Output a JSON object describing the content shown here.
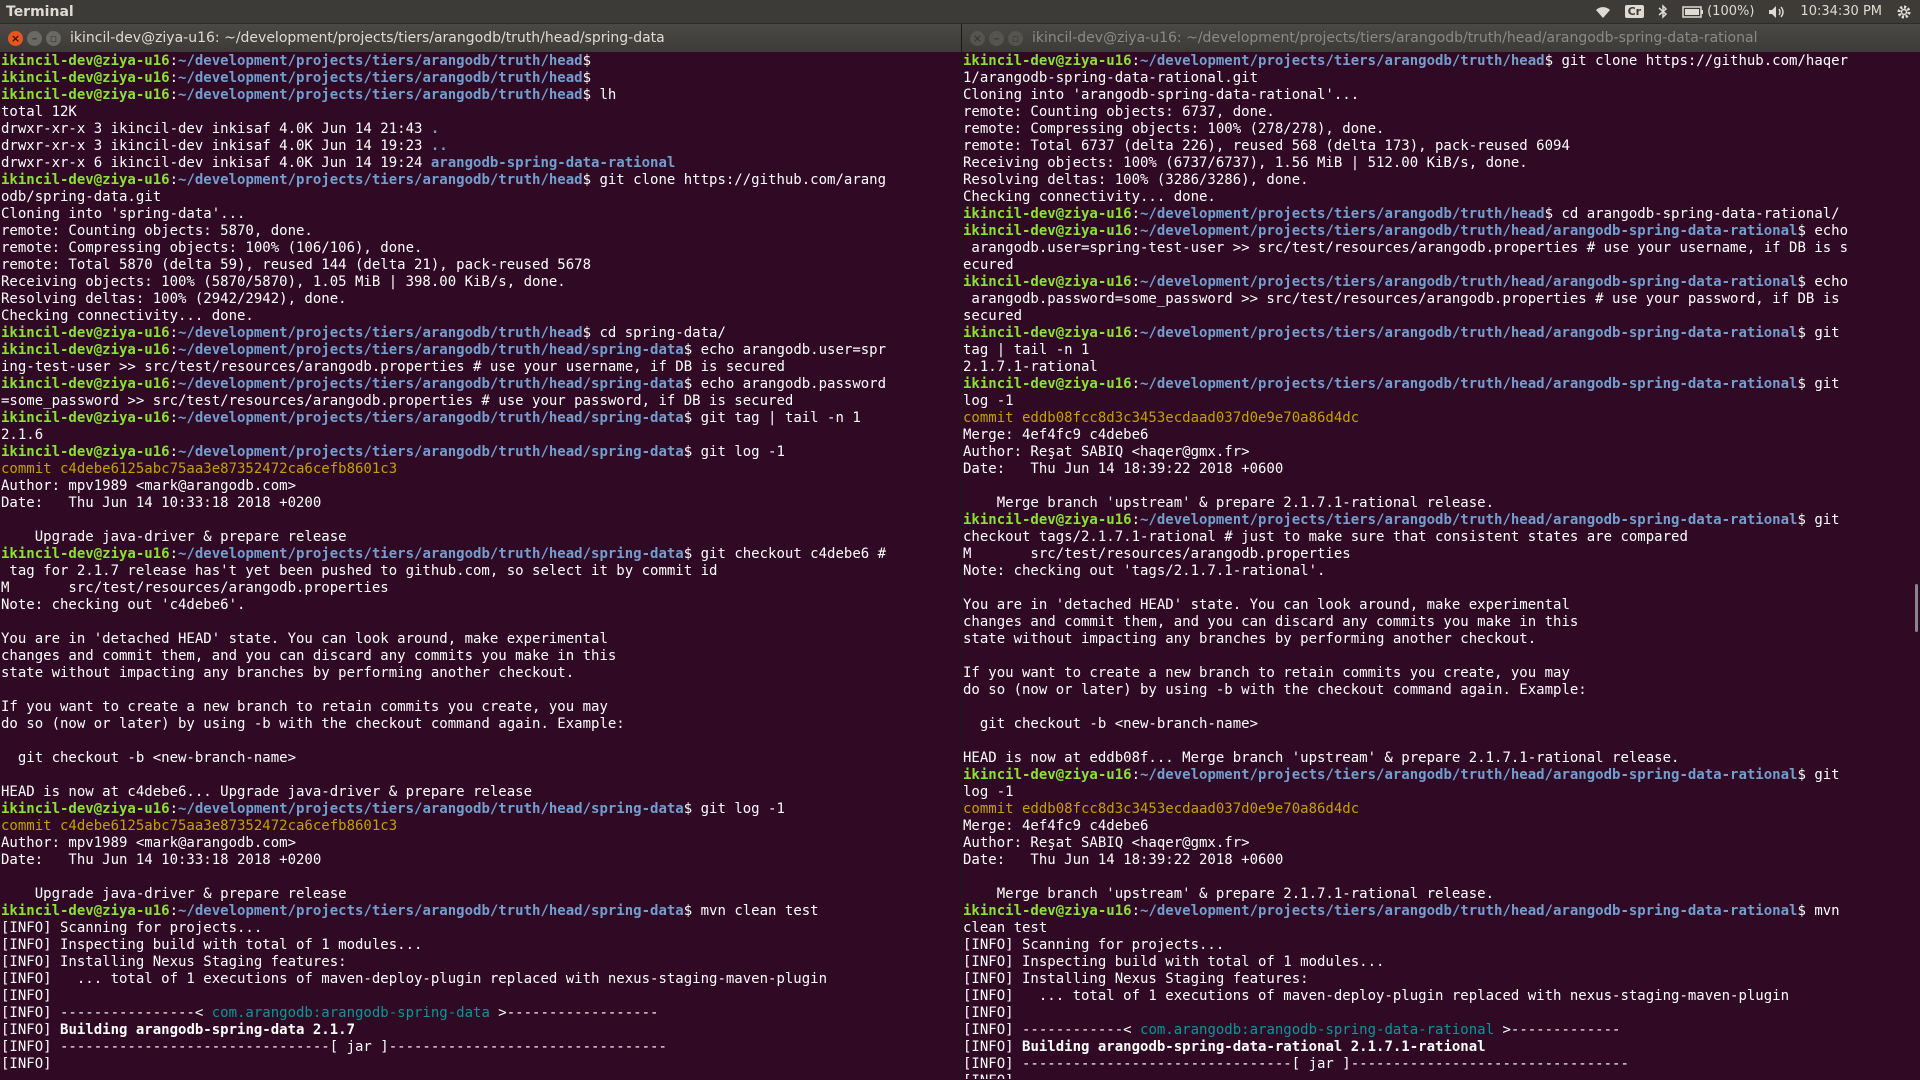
{
  "topbar": {
    "app_title": "Terminal",
    "keyboard_layout": "Cr",
    "battery": "(100%)",
    "time": "10:34:30 PM",
    "icons": [
      "wifi-icon",
      "keyboard-layout-indicator",
      "bluetooth-icon",
      "battery-icon",
      "volume-icon",
      "gear-icon"
    ]
  },
  "windows": [
    {
      "id": "left",
      "title": "ikincil-dev@ziya-u16: ~/development/projects/tiers/arangodb/truth/head/spring-data",
      "active": true,
      "lines": [
        {
          "t": "p",
          "u": "ikincil-dev@ziya-u16",
          "p": "~/development/projects/tiers/arangodb/truth/head",
          "cmd": ""
        },
        {
          "t": "p",
          "u": "ikincil-dev@ziya-u16",
          "p": "~/development/projects/tiers/arangodb/truth/head",
          "cmd": ""
        },
        {
          "t": "p",
          "u": "ikincil-dev@ziya-u16",
          "p": "~/development/projects/tiers/arangodb/truth/head",
          "cmd": " lh"
        },
        {
          "t": "o",
          "s": "total 12K"
        },
        {
          "t": "o",
          "s": "drwxr-xr-x 3 ikincil-dev inkisaf 4.0K Jun 14 21:43 ",
          "dir": "."
        },
        {
          "t": "o",
          "s": "drwxr-xr-x 3 ikincil-dev inkisaf 4.0K Jun 14 19:23 ",
          "dir": ".."
        },
        {
          "t": "o",
          "s": "drwxr-xr-x 6 ikincil-dev inkisaf 4.0K Jun 14 19:24 ",
          "dir": "arangodb-spring-data-rational"
        },
        {
          "t": "p",
          "u": "ikincil-dev@ziya-u16",
          "p": "~/development/projects/tiers/arangodb/truth/head",
          "cmd": " git clone https://github.com/arang"
        },
        {
          "t": "o",
          "s": "odb/spring-data.git"
        },
        {
          "t": "o",
          "s": "Cloning into 'spring-data'..."
        },
        {
          "t": "o",
          "s": "remote: Counting objects: 5870, done."
        },
        {
          "t": "o",
          "s": "remote: Compressing objects: 100% (106/106), done."
        },
        {
          "t": "o",
          "s": "remote: Total 5870 (delta 59), reused 144 (delta 21), pack-reused 5678"
        },
        {
          "t": "o",
          "s": "Receiving objects: 100% (5870/5870), 1.05 MiB | 398.00 KiB/s, done."
        },
        {
          "t": "o",
          "s": "Resolving deltas: 100% (2942/2942), done."
        },
        {
          "t": "o",
          "s": "Checking connectivity... done."
        },
        {
          "t": "p",
          "u": "ikincil-dev@ziya-u16",
          "p": "~/development/projects/tiers/arangodb/truth/head",
          "cmd": " cd spring-data/"
        },
        {
          "t": "p",
          "u": "ikincil-dev@ziya-u16",
          "p": "~/development/projects/tiers/arangodb/truth/head/spring-data",
          "cmd": " echo arangodb.user=spr"
        },
        {
          "t": "o",
          "s": "ing-test-user >> src/test/resources/arangodb.properties # use your username, if DB is secured"
        },
        {
          "t": "p",
          "u": "ikincil-dev@ziya-u16",
          "p": "~/development/projects/tiers/arangodb/truth/head/spring-data",
          "cmd": " echo arangodb.password"
        },
        {
          "t": "o",
          "s": "=some_password >> src/test/resources/arangodb.properties # use your password, if DB is secured"
        },
        {
          "t": "p",
          "u": "ikincil-dev@ziya-u16",
          "p": "~/development/projects/tiers/arangodb/truth/head/spring-data",
          "cmd": " git tag | tail -n 1"
        },
        {
          "t": "o",
          "s": "2.1.6"
        },
        {
          "t": "p",
          "u": "ikincil-dev@ziya-u16",
          "p": "~/development/projects/tiers/arangodb/truth/head/spring-data",
          "cmd": " git log -1"
        },
        {
          "t": "h",
          "s": "commit c4debe6125abc75aa3e87352472ca6cefb8601c3"
        },
        {
          "t": "o",
          "s": "Author: mpv1989 <mark@arangodb.com>"
        },
        {
          "t": "o",
          "s": "Date:   Thu Jun 14 10:33:18 2018 +0200"
        },
        {
          "t": "o",
          "s": ""
        },
        {
          "t": "o",
          "s": "    Upgrade java-driver & prepare release"
        },
        {
          "t": "p",
          "u": "ikincil-dev@ziya-u16",
          "p": "~/development/projects/tiers/arangodb/truth/head/spring-data",
          "cmd": " git checkout c4debe6 #"
        },
        {
          "t": "o",
          "s": " tag for 2.1.7 release has't yet been pushed to github.com, so select it by commit id"
        },
        {
          "t": "o",
          "s": "M       src/test/resources/arangodb.properties"
        },
        {
          "t": "o",
          "s": "Note: checking out 'c4debe6'."
        },
        {
          "t": "o",
          "s": ""
        },
        {
          "t": "o",
          "s": "You are in 'detached HEAD' state. You can look around, make experimental"
        },
        {
          "t": "o",
          "s": "changes and commit them, and you can discard any commits you make in this"
        },
        {
          "t": "o",
          "s": "state without impacting any branches by performing another checkout."
        },
        {
          "t": "o",
          "s": ""
        },
        {
          "t": "o",
          "s": "If you want to create a new branch to retain commits you create, you may"
        },
        {
          "t": "o",
          "s": "do so (now or later) by using -b with the checkout command again. Example:"
        },
        {
          "t": "o",
          "s": ""
        },
        {
          "t": "o",
          "s": "  git checkout -b <new-branch-name>"
        },
        {
          "t": "o",
          "s": ""
        },
        {
          "t": "o",
          "s": "HEAD is now at c4debe6... Upgrade java-driver & prepare release"
        },
        {
          "t": "p",
          "u": "ikincil-dev@ziya-u16",
          "p": "~/development/projects/tiers/arangodb/truth/head/spring-data",
          "cmd": " git log -1"
        },
        {
          "t": "h",
          "s": "commit c4debe6125abc75aa3e87352472ca6cefb8601c3"
        },
        {
          "t": "o",
          "s": "Author: mpv1989 <mark@arangodb.com>"
        },
        {
          "t": "o",
          "s": "Date:   Thu Jun 14 10:33:18 2018 +0200"
        },
        {
          "t": "o",
          "s": ""
        },
        {
          "t": "o",
          "s": "    Upgrade java-driver & prepare release"
        },
        {
          "t": "p",
          "u": "ikincil-dev@ziya-u16",
          "p": "~/development/projects/tiers/arangodb/truth/head/spring-data",
          "cmd": " mvn clean test"
        },
        {
          "t": "o",
          "s": "[INFO] Scanning for projects..."
        },
        {
          "t": "o",
          "s": "[INFO] Inspecting build with total of 1 modules..."
        },
        {
          "t": "o",
          "s": "[INFO] Installing Nexus Staging features:"
        },
        {
          "t": "o",
          "s": "[INFO]   ... total of 1 executions of maven-deploy-plugin replaced with nexus-staging-maven-plugin"
        },
        {
          "t": "o",
          "s": "[INFO]"
        },
        {
          "t": "a",
          "pre": "[INFO] ----------------< ",
          "art": "com.arangodb:arangodb-spring-data",
          "post": " >------------------"
        },
        {
          "t": "bi",
          "pre": "[INFO] ",
          "s": "Building arangodb-spring-data 2.1.7"
        },
        {
          "t": "o",
          "s": "[INFO] --------------------------------[ jar ]---------------------------------"
        },
        {
          "t": "o",
          "s": "[INFO]"
        }
      ]
    },
    {
      "id": "right",
      "title": "ikincil-dev@ziya-u16: ~/development/projects/tiers/arangodb/truth/head/arangodb-spring-data-rational",
      "active": false,
      "lines": [
        {
          "t": "p",
          "u": "ikincil-dev@ziya-u16",
          "p": "~/development/projects/tiers/arangodb/truth/head",
          "cmd": " git clone https://github.com/haqer"
        },
        {
          "t": "o",
          "s": "1/arangodb-spring-data-rational.git"
        },
        {
          "t": "o",
          "s": "Cloning into 'arangodb-spring-data-rational'..."
        },
        {
          "t": "o",
          "s": "remote: Counting objects: 6737, done."
        },
        {
          "t": "o",
          "s": "remote: Compressing objects: 100% (278/278), done."
        },
        {
          "t": "o",
          "s": "remote: Total 6737 (delta 226), reused 568 (delta 173), pack-reused 6094"
        },
        {
          "t": "o",
          "s": "Receiving objects: 100% (6737/6737), 1.56 MiB | 512.00 KiB/s, done."
        },
        {
          "t": "o",
          "s": "Resolving deltas: 100% (3286/3286), done."
        },
        {
          "t": "o",
          "s": "Checking connectivity... done."
        },
        {
          "t": "p",
          "u": "ikincil-dev@ziya-u16",
          "p": "~/development/projects/tiers/arangodb/truth/head",
          "cmd": " cd arangodb-spring-data-rational/"
        },
        {
          "t": "p",
          "u": "ikincil-dev@ziya-u16",
          "p": "~/development/projects/tiers/arangodb/truth/head/arangodb-spring-data-rational",
          "cmd": " echo"
        },
        {
          "t": "o",
          "s": " arangodb.user=spring-test-user >> src/test/resources/arangodb.properties # use your username, if DB is s"
        },
        {
          "t": "o",
          "s": "ecured"
        },
        {
          "t": "p",
          "u": "ikincil-dev@ziya-u16",
          "p": "~/development/projects/tiers/arangodb/truth/head/arangodb-spring-data-rational",
          "cmd": " echo"
        },
        {
          "t": "o",
          "s": " arangodb.password=some_password >> src/test/resources/arangodb.properties # use your password, if DB is"
        },
        {
          "t": "o",
          "s": "secured"
        },
        {
          "t": "p",
          "u": "ikincil-dev@ziya-u16",
          "p": "~/development/projects/tiers/arangodb/truth/head/arangodb-spring-data-rational",
          "cmd": " git"
        },
        {
          "t": "o",
          "s": "tag | tail -n 1"
        },
        {
          "t": "o",
          "s": "2.1.7.1-rational"
        },
        {
          "t": "p",
          "u": "ikincil-dev@ziya-u16",
          "p": "~/development/projects/tiers/arangodb/truth/head/arangodb-spring-data-rational",
          "cmd": " git"
        },
        {
          "t": "o",
          "s": "log -1"
        },
        {
          "t": "h",
          "s": "commit eddb08fcc8d3c3453ecdaad037d0e9e70a86d4dc"
        },
        {
          "t": "o",
          "s": "Merge: 4ef4fc9 c4debe6"
        },
        {
          "t": "o",
          "s": "Author: Reşat SABIQ <haqer@gmx.fr>"
        },
        {
          "t": "o",
          "s": "Date:   Thu Jun 14 18:39:22 2018 +0600"
        },
        {
          "t": "o",
          "s": ""
        },
        {
          "t": "o",
          "s": "    Merge branch 'upstream' & prepare 2.1.7.1-rational release."
        },
        {
          "t": "p",
          "u": "ikincil-dev@ziya-u16",
          "p": "~/development/projects/tiers/arangodb/truth/head/arangodb-spring-data-rational",
          "cmd": " git"
        },
        {
          "t": "o",
          "s": "checkout tags/2.1.7.1-rational # just to make sure that consistent states are compared"
        },
        {
          "t": "o",
          "s": "M       src/test/resources/arangodb.properties"
        },
        {
          "t": "o",
          "s": "Note: checking out 'tags/2.1.7.1-rational'."
        },
        {
          "t": "o",
          "s": ""
        },
        {
          "t": "o",
          "s": "You are in 'detached HEAD' state. You can look around, make experimental"
        },
        {
          "t": "o",
          "s": "changes and commit them, and you can discard any commits you make in this"
        },
        {
          "t": "o",
          "s": "state without impacting any branches by performing another checkout."
        },
        {
          "t": "o",
          "s": ""
        },
        {
          "t": "o",
          "s": "If you want to create a new branch to retain commits you create, you may"
        },
        {
          "t": "o",
          "s": "do so (now or later) by using -b with the checkout command again. Example:"
        },
        {
          "t": "o",
          "s": ""
        },
        {
          "t": "o",
          "s": "  git checkout -b <new-branch-name>"
        },
        {
          "t": "o",
          "s": ""
        },
        {
          "t": "o",
          "s": "HEAD is now at eddb08f... Merge branch 'upstream' & prepare 2.1.7.1-rational release."
        },
        {
          "t": "p",
          "u": "ikincil-dev@ziya-u16",
          "p": "~/development/projects/tiers/arangodb/truth/head/arangodb-spring-data-rational",
          "cmd": " git"
        },
        {
          "t": "o",
          "s": "log -1"
        },
        {
          "t": "h",
          "s": "commit eddb08fcc8d3c3453ecdaad037d0e9e70a86d4dc"
        },
        {
          "t": "o",
          "s": "Merge: 4ef4fc9 c4debe6"
        },
        {
          "t": "o",
          "s": "Author: Reşat SABIQ <haqer@gmx.fr>"
        },
        {
          "t": "o",
          "s": "Date:   Thu Jun 14 18:39:22 2018 +0600"
        },
        {
          "t": "o",
          "s": ""
        },
        {
          "t": "o",
          "s": "    Merge branch 'upstream' & prepare 2.1.7.1-rational release."
        },
        {
          "t": "p",
          "u": "ikincil-dev@ziya-u16",
          "p": "~/development/projects/tiers/arangodb/truth/head/arangodb-spring-data-rational",
          "cmd": " mvn"
        },
        {
          "t": "o",
          "s": "clean test"
        },
        {
          "t": "o",
          "s": "[INFO] Scanning for projects..."
        },
        {
          "t": "o",
          "s": "[INFO] Inspecting build with total of 1 modules..."
        },
        {
          "t": "o",
          "s": "[INFO] Installing Nexus Staging features:"
        },
        {
          "t": "o",
          "s": "[INFO]   ... total of 1 executions of maven-deploy-plugin replaced with nexus-staging-maven-plugin"
        },
        {
          "t": "o",
          "s": "[INFO]"
        },
        {
          "t": "a",
          "pre": "[INFO] ------------< ",
          "art": "com.arangodb:arangodb-spring-data-rational",
          "post": " >-------------"
        },
        {
          "t": "bi",
          "pre": "[INFO] ",
          "s": "Building arangodb-spring-data-rational 2.1.7.1-rational"
        },
        {
          "t": "o",
          "s": "[INFO] --------------------------------[ jar ]---------------------------------"
        },
        {
          "t": "o",
          "s": "[INFO]"
        }
      ]
    }
  ]
}
